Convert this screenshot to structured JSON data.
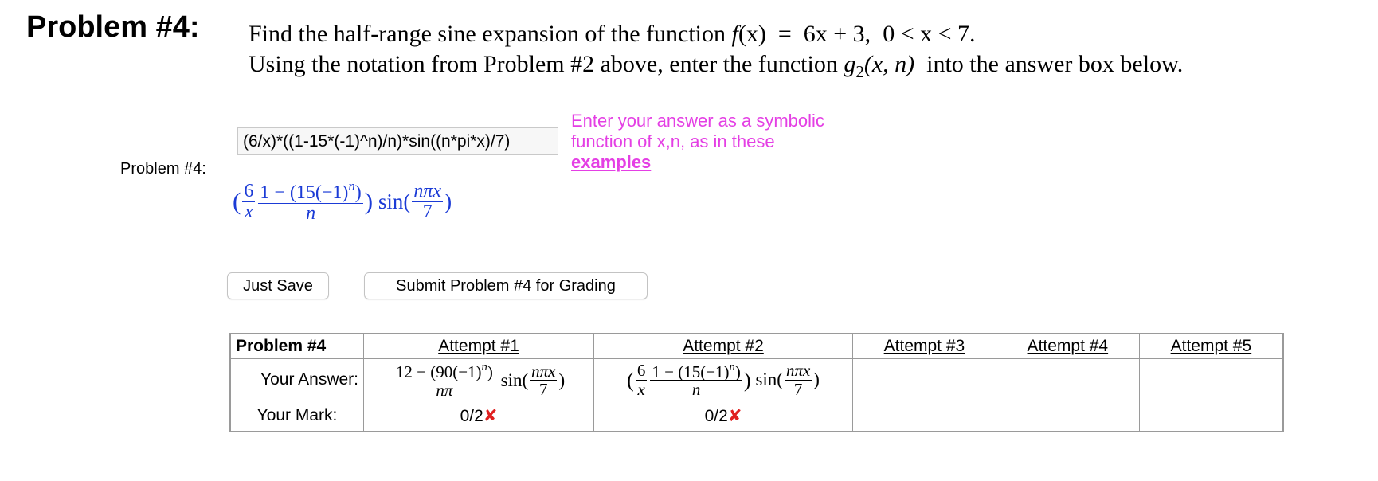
{
  "header": {
    "title": "Problem #4:",
    "line1_text": "Find the half-range sine expansion of the function",
    "line1_func": "f",
    "line1_arg": "(x)",
    "line1_eq": "=",
    "line1_expr": "6x + 3,",
    "line1_domain": "0 < x < 7.",
    "line2_text": "Using the notation from Problem #2 above, enter the function",
    "line2_func": "g",
    "line2_sub": "2",
    "line2_args": "(x, n)",
    "line2_tail": "into the answer box below."
  },
  "side_label": "Problem #4:",
  "answer_input": {
    "value": "(6/x)*((1-15*(-1)^n)/n)*sin((n*pi*x)/7)"
  },
  "hint": {
    "line1": "Enter your answer as a symbolic",
    "line2": "function of x,n, as in these",
    "link": "examples"
  },
  "preview": {
    "open": "(",
    "f1_num": "6",
    "f1_den": "x",
    "f2_num": "1 − (15(−1)",
    "f2_exp": "n",
    "f2_close": ")",
    "f2_den": "n",
    "close": ")",
    "sin": "sin(",
    "f3_num": "nπx",
    "f3_den": "7",
    "sin_close": ")"
  },
  "buttons": {
    "save": "Just Save",
    "submit": "Submit Problem #4 for Grading"
  },
  "table": {
    "row_header": "Problem #4",
    "attempts": [
      "Attempt #1",
      "Attempt #2",
      "Attempt #3",
      "Attempt #4",
      "Attempt #5"
    ],
    "answer_label": "Your Answer:",
    "mark_label": "Your Mark:",
    "attempt1": {
      "num": "12 − (90(−1)",
      "exp": "n",
      "num_close": ")",
      "den": "nπ",
      "sin": "sin(",
      "arg_num": "nπx",
      "arg_den": "7",
      "sin_close": ")",
      "mark": "0/2"
    },
    "attempt2": {
      "open": "(",
      "f1_num": "6",
      "f1_den": "x",
      "f2_num": "1 − (15(−1)",
      "f2_exp": "n",
      "f2_close": ")",
      "f2_den": "n",
      "close": ")",
      "sin": "sin(",
      "arg_num": "nπx",
      "arg_den": "7",
      "sin_close": ")",
      "mark": "0/2"
    },
    "wrong_symbol": "✘"
  }
}
